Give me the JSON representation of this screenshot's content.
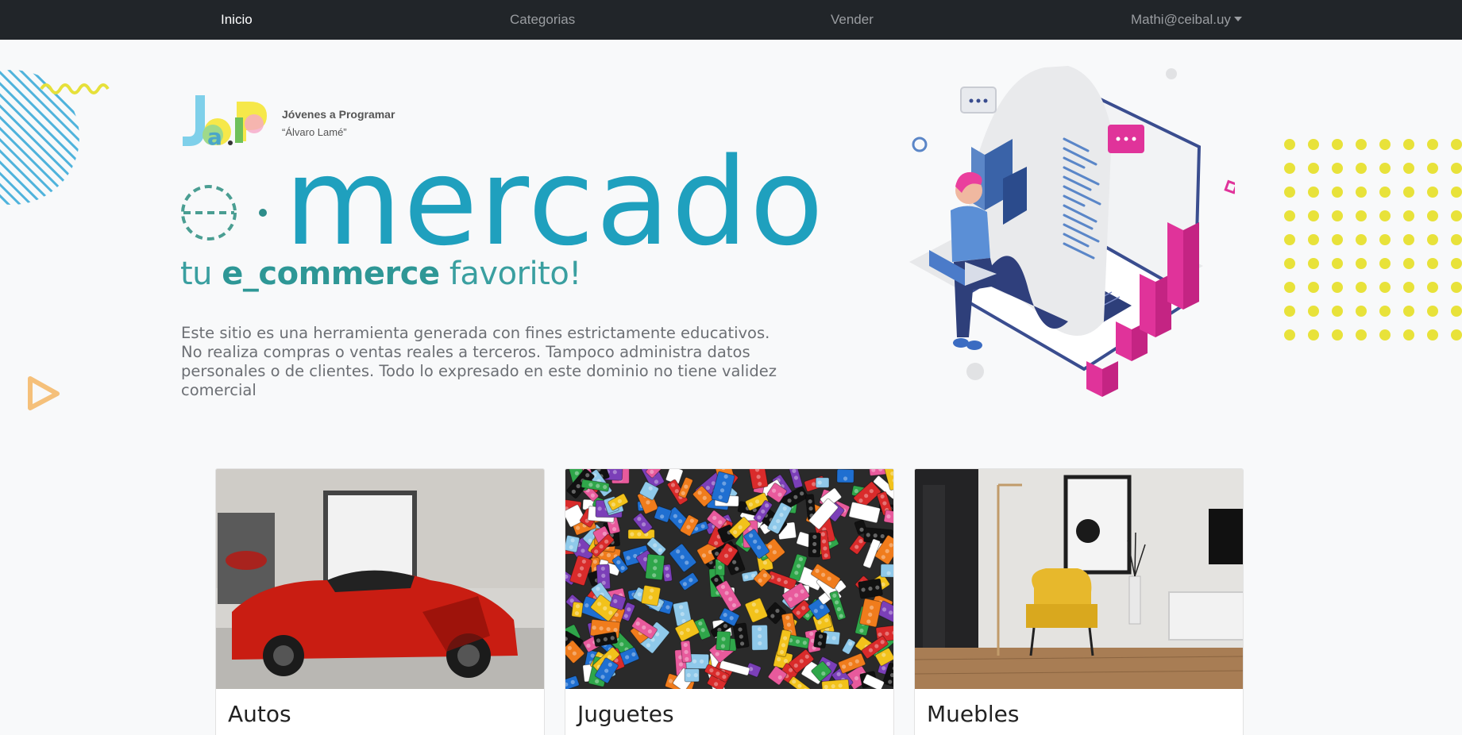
{
  "nav": {
    "home": "Inicio",
    "categories": "Categorias",
    "sell": "Vender",
    "user": "Mathi@ceibal.uy"
  },
  "brand": {
    "logo_text": "JaP",
    "org_line1": "Jóvenes a Programar",
    "org_line2": "“Álvaro Lamé”",
    "title": "mercado",
    "tagline_pre": "tu ",
    "tagline_bold": "e_commerce",
    "tagline_post": " favorito!",
    "description": "Este sitio  es una herramienta generada con fines estrictamente educativos. No realiza compras o ventas reales a terceros. Tampoco administra datos personales o de clientes. Todo lo expresado en este dominio no tiene validez comercial"
  },
  "cards": [
    {
      "title": "Autos",
      "image": "red-sports-car-photo"
    },
    {
      "title": "Juguetes",
      "image": "lego-bricks-photo"
    },
    {
      "title": "Muebles",
      "image": "yellow-armchair-room-photo"
    }
  ],
  "colors": {
    "navbar": "#212529",
    "brand_teal": "#1fa0be",
    "tagline_green": "#3a9fa0",
    "dots_yellow": "#e8e23a",
    "pink": "#e0339a",
    "navy": "#3a4d8f"
  }
}
